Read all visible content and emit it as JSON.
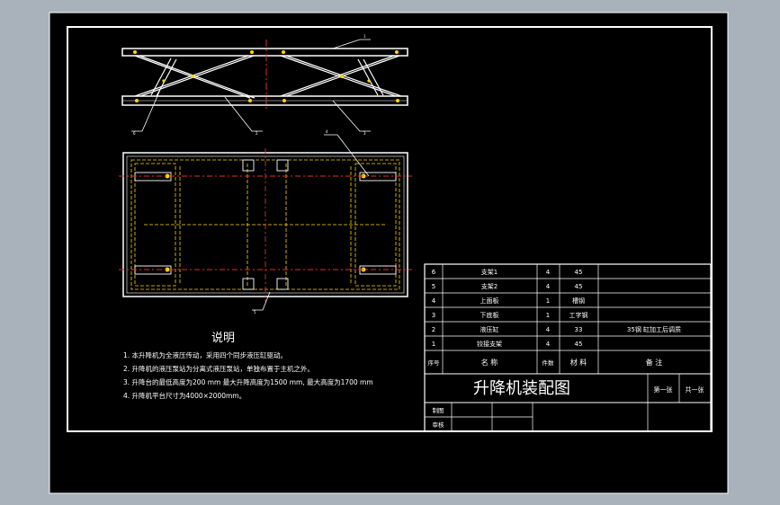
{
  "notes": {
    "title": "说明",
    "lines": [
      "1. 本升降机为全液压传动，采用四个同步液压缸驱动。",
      "2. 升降机的液压泵站为分离式液压泵站，单独布置于主机之外。",
      "3. 升降台的最低高度为200 mm  最大升降高度为1500 mm, 最大高度为1700 mm",
      "4. 升降机平台尺寸为4000×2000mm。"
    ]
  },
  "parts_table": {
    "rows": [
      {
        "no": "6",
        "name": "支架1",
        "qty": "4",
        "material": "45",
        "remark": ""
      },
      {
        "no": "5",
        "name": "支架2",
        "qty": "4",
        "material": "45",
        "remark": ""
      },
      {
        "no": "4",
        "name": "上面板",
        "qty": "1",
        "material": "槽钢",
        "remark": ""
      },
      {
        "no": "3",
        "name": "下底板",
        "qty": "1",
        "material": "工字钢",
        "remark": ""
      },
      {
        "no": "2",
        "name": "液压缸",
        "qty": "4",
        "material": "33",
        "remark": "35钢 缸加工后调质"
      },
      {
        "no": "1",
        "name": "铰接支架",
        "qty": "4",
        "material": "45",
        "remark": ""
      }
    ],
    "header": {
      "no": "序号",
      "name": "名  称",
      "qty": "件数",
      "material": "材  料",
      "remark": "备  注"
    }
  },
  "title_block": {
    "drawing_title": "升降机装配图",
    "sheet_label": "第一张",
    "total_label": "共一张",
    "drawn_label": "制图",
    "checked_label": "审核"
  },
  "callout_numbers": [
    "1",
    "6",
    "2",
    "3",
    "4",
    "5"
  ]
}
